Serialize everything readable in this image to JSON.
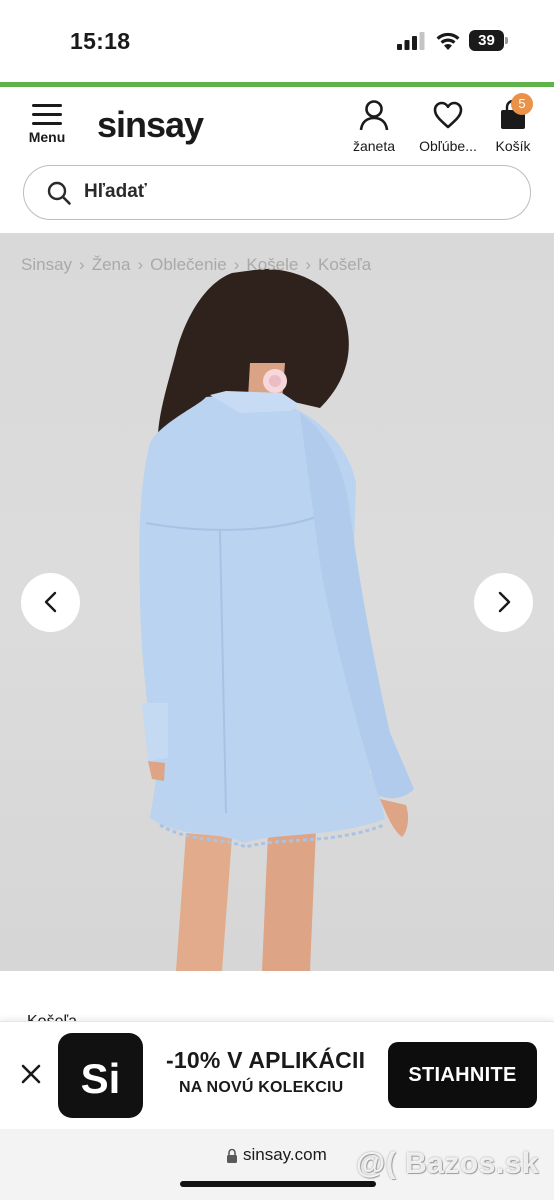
{
  "status_bar": {
    "time": "15:18",
    "battery_level": "39"
  },
  "header": {
    "menu_label": "Menu",
    "logo": "sinsay",
    "account_label": "žaneta",
    "wishlist_label": "Obľúbe...",
    "cart_label": "Košík",
    "cart_count": "5"
  },
  "search": {
    "placeholder": "Hľadať"
  },
  "breadcrumb": [
    "Sinsay",
    "Žena",
    "Oblečenie",
    "Košele",
    "Košeľa"
  ],
  "product": {
    "title_peek": "Košeľa"
  },
  "app_banner": {
    "logo_text": "Si",
    "promo_main": "-10% V APLIKÁCII",
    "promo_sub": "NA NOVÚ KOLEKCIU",
    "download_label": "STIAHNITE"
  },
  "browser": {
    "url": "sinsay.com"
  },
  "watermark": "@( Bazos.sk",
  "colors": {
    "accent_green": "#5fb34a",
    "badge_orange": "#e8924a",
    "shirt_blue": "#b9d3f0"
  },
  "icons": {
    "menu": "hamburger-icon",
    "account": "user-icon",
    "wishlist": "heart-icon",
    "cart": "shopping-bag-icon",
    "search": "search-icon",
    "prev": "chevron-left-icon",
    "next": "chevron-right-icon",
    "close": "close-icon",
    "lock": "lock-icon"
  }
}
